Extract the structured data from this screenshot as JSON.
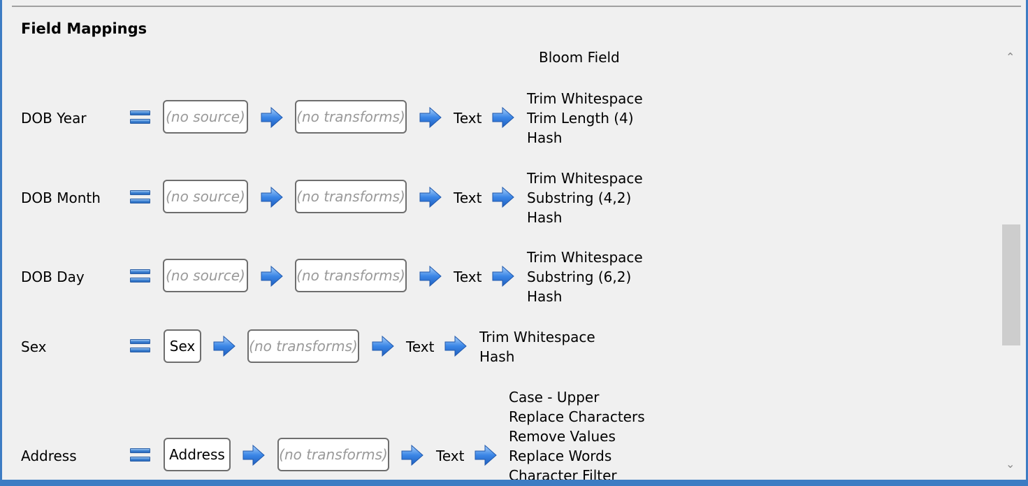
{
  "section_title": "Field Mappings",
  "column_header": "Bloom Field",
  "rows": [
    {
      "label": "DOB Year",
      "source": "(no source)",
      "transforms": "(no transforms)",
      "type": "Text",
      "steps": [
        "Trim Whitespace",
        "Trim Length (4)",
        "Hash"
      ]
    },
    {
      "label": "DOB Month",
      "source": "(no source)",
      "transforms": "(no transforms)",
      "type": "Text",
      "steps": [
        "Trim Whitespace",
        "Substring (4,2)",
        "Hash"
      ]
    },
    {
      "label": "DOB Day",
      "source": "(no source)",
      "transforms": "(no transforms)",
      "type": "Text",
      "steps": [
        "Trim Whitespace",
        "Substring (6,2)",
        "Hash"
      ]
    },
    {
      "label": "Sex",
      "source": "Sex",
      "transforms": "(no transforms)",
      "type": "Text",
      "steps": [
        "Trim Whitespace",
        "Hash"
      ]
    },
    {
      "label": "Address",
      "source": "Address",
      "transforms": "(no transforms)",
      "type": "Text",
      "steps": [
        "Case - Upper",
        "Replace Characters",
        "Remove Values",
        "Replace Words",
        "Character Filter"
      ]
    }
  ],
  "scroll": {
    "up": "^",
    "down": "v"
  },
  "colors": {
    "accent": "#3d7cc3",
    "arrow": "#2f7be0"
  }
}
